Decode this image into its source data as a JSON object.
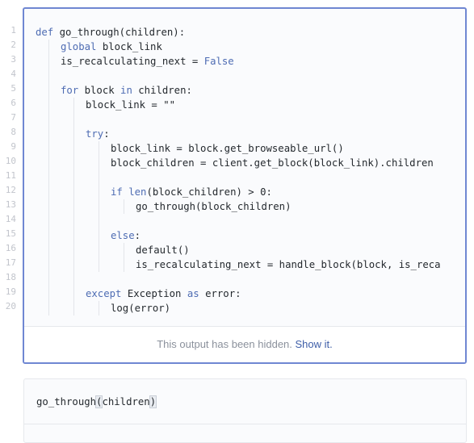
{
  "cell1": {
    "line_numbers": [
      "1",
      "2",
      "3",
      "4",
      "5",
      "6",
      "7",
      "8",
      "9",
      "10",
      "11",
      "12",
      "13",
      "14",
      "15",
      "16",
      "17",
      "18",
      "19",
      "20"
    ],
    "lines": [
      {
        "indent": 0,
        "tokens": [
          {
            "t": "def",
            "k": true
          },
          {
            "t": " go_through(children):"
          }
        ]
      },
      {
        "indent": 1,
        "tokens": [
          {
            "t": "global",
            "k": true
          },
          {
            "t": " block_link"
          }
        ]
      },
      {
        "indent": 1,
        "tokens": [
          {
            "t": "is_recalculating_next = "
          },
          {
            "t": "False",
            "k": true
          }
        ]
      },
      {
        "indent": 0,
        "tokens": []
      },
      {
        "indent": 1,
        "tokens": [
          {
            "t": "for",
            "k": true
          },
          {
            "t": " block "
          },
          {
            "t": "in",
            "k": true
          },
          {
            "t": " children:"
          }
        ]
      },
      {
        "indent": 2,
        "tokens": [
          {
            "t": "block_link = \"\""
          }
        ]
      },
      {
        "indent": 0,
        "tokens": []
      },
      {
        "indent": 2,
        "tokens": [
          {
            "t": "try",
            "k": true
          },
          {
            "t": ":"
          }
        ]
      },
      {
        "indent": 3,
        "tokens": [
          {
            "t": "block_link = block.get_browseable_url()"
          }
        ]
      },
      {
        "indent": 3,
        "tokens": [
          {
            "t": "block_children = client.get_block(block_link).children"
          }
        ]
      },
      {
        "indent": 0,
        "tokens": []
      },
      {
        "indent": 3,
        "tokens": [
          {
            "t": "if",
            "k": true
          },
          {
            "t": " "
          },
          {
            "t": "len",
            "k": true
          },
          {
            "t": "(block_children) > 0:"
          }
        ]
      },
      {
        "indent": 4,
        "tokens": [
          {
            "t": "go_through(block_children)"
          }
        ]
      },
      {
        "indent": 0,
        "tokens": []
      },
      {
        "indent": 3,
        "tokens": [
          {
            "t": "else",
            "k": true
          },
          {
            "t": ":"
          }
        ]
      },
      {
        "indent": 4,
        "tokens": [
          {
            "t": "default()"
          }
        ]
      },
      {
        "indent": 4,
        "tokens": [
          {
            "t": "is_recalculating_next = handle_block(block, is_reca"
          }
        ]
      },
      {
        "indent": 0,
        "tokens": []
      },
      {
        "indent": 2,
        "tokens": [
          {
            "t": "except",
            "k": true
          },
          {
            "t": " Exception "
          },
          {
            "t": "as",
            "k": true
          },
          {
            "t": " error:"
          }
        ]
      },
      {
        "indent": 3,
        "tokens": [
          {
            "t": "log(error)"
          }
        ]
      }
    ],
    "output_notice": {
      "text": "This output has been hidden. ",
      "link": "Show it."
    }
  },
  "cell2": {
    "code_prefix": "go_through",
    "code_open": "(",
    "code_arg": "children",
    "code_close": ")"
  },
  "colors": {
    "keyword": "#4e6cb3",
    "active_border": "#6f87d2",
    "link": "#3e5ea8"
  }
}
